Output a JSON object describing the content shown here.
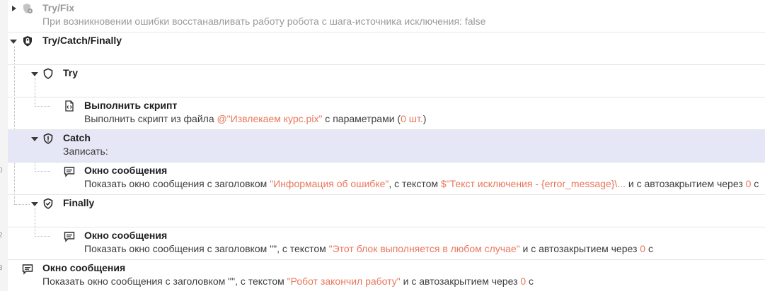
{
  "colors": {
    "highlight": "#e8765c",
    "selected_row": "#e5e7f6",
    "text": "#1e1e1e"
  },
  "gutter": {
    "labels": [
      "0",
      "2",
      "3"
    ]
  },
  "tree": {
    "tryfix": {
      "title": "Try/Fix",
      "desc": "При возникновении ошибки восстанавливать работу робота с шага-источника исключения: false",
      "icon": "gear-shield-icon"
    },
    "trycatch": {
      "title": "Try/Catch/Finally",
      "icon": "shield-lock-icon"
    },
    "try": {
      "title": "Try",
      "icon": "shield-icon"
    },
    "run_script": {
      "title": "Выполнить скрипт",
      "desc_prefix": "Выполнить скрипт из файла ",
      "file": "@\"Извлекаем курс.pix\"",
      "desc_mid": " с параметрами (",
      "count": "0 шт.",
      "desc_suffix": ")",
      "icon": "script-file-icon"
    },
    "catch": {
      "title": "Catch",
      "desc": "Записать:",
      "icon": "shield-exclamation-icon"
    },
    "msg_catch": {
      "title": "Окно сообщения",
      "p1": "Показать окно сообщения с заголовком ",
      "header": "\"Информация об ошибке\"",
      "p2": ", с текстом ",
      "text": "$\"Текст исключения - {error_message}\\...",
      "p3": " и с автозакрытием через ",
      "seconds": "0",
      "p4": " с",
      "icon": "message-box-icon"
    },
    "finally": {
      "title": "Finally",
      "icon": "shield-check-icon"
    },
    "msg_finally": {
      "title": "Окно сообщения",
      "p1": "Показать окно сообщения с заголовком \"\", с текстом ",
      "text": "\"Этот блок выполняется в любом случае\"",
      "p2": " и с автозакрытием через ",
      "seconds": "0",
      "p3": " с",
      "icon": "message-box-icon"
    },
    "msg_end": {
      "title": "Окно сообщения",
      "p1": "Показать окно сообщения с заголовком \"\", с текстом ",
      "text": "\"Робот закончил работу\"",
      "p2": " и с автозакрытием через ",
      "seconds": "0",
      "p3": " с",
      "icon": "message-box-icon"
    }
  }
}
